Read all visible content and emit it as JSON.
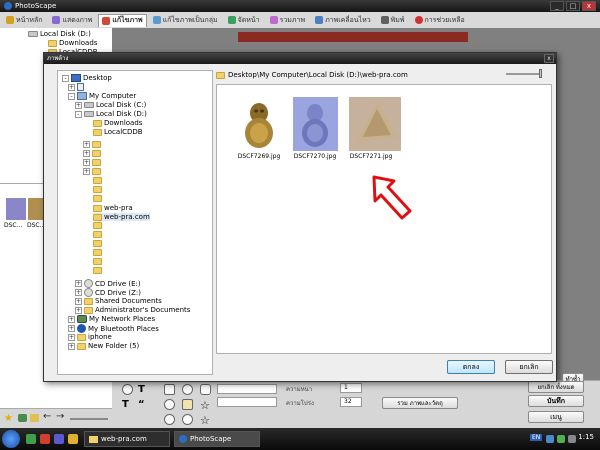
{
  "app": {
    "title": "PhotoScape",
    "tabs": [
      {
        "label": "หน้าหลัก",
        "color": "#d4a020"
      },
      {
        "label": "แสดงภาพ",
        "color": "#8a6ad0"
      },
      {
        "label": "แก้ไขภาพ",
        "color": "#d04a3a"
      },
      {
        "label": "แก้ไขภาพเป็นกลุ่ม",
        "color": "#5a9ad0"
      },
      {
        "label": "จัดหน้า",
        "color": "#3aa060"
      },
      {
        "label": "รวมภาพ",
        "color": "#c06ad0"
      },
      {
        "label": "ภาพเคลื่อนไหว",
        "color": "#4a80c0"
      },
      {
        "label": "พิมพ์",
        "color": "#606060"
      },
      {
        "label": "การช่วยเหลือ",
        "color": "#d03030"
      }
    ],
    "active_tab": 2
  },
  "side_tree": {
    "drive": "Local Disk (D:)",
    "items": [
      "Downloads",
      "LocalCDDB"
    ]
  },
  "side_thumbs": {
    "labels": [
      "DSC...",
      "DSC..."
    ]
  },
  "dialog": {
    "title": "ภาพต้าง",
    "close": "x",
    "path": "Desktop\\My Computer\\Local Disk (D:)\\web-pra.com",
    "tree": {
      "desktop": "Desktop",
      "my_computer": "My Computer",
      "drive_c": "Local Disk (C:)",
      "drive_d": "Local Disk (D:)",
      "d_children": [
        "Downloads",
        "LocalCDDB"
      ],
      "web_pra": "web-pra",
      "web_pra_com": "web-pra.com",
      "drive_e": "CD Drive (E:)",
      "drive_z": "CD Drive (Z:)",
      "shared": "Shared Documents",
      "admin_docs": "Administrator's Documents",
      "network": "My Network Places",
      "bluetooth": "My Bluetooth Places",
      "iphone": "iphone",
      "new_folder": "New Folder (5)"
    },
    "files": [
      {
        "name": "DSCF7269.jpg"
      },
      {
        "name": "DSCF7270.jpg"
      },
      {
        "name": "DSCF7271.jpg"
      }
    ],
    "selected_file": 1,
    "ok_label": "ตกลง",
    "cancel_label": "ยกเลิก"
  },
  "bottom": {
    "label_size": "ความหนา",
    "label_opacity": "ความโปร่ง",
    "size_value": "1",
    "opacity_value": "32",
    "merge_label": "รวม ภาพและวัตถุ",
    "undo_label": "ทำซ้ำ",
    "cancel_all_label": "ยกเลิก ทั้งหมด",
    "save_label": "บันทึก",
    "menu_label": "เมนู"
  },
  "taskbar": {
    "items": [
      {
        "label": "web-pra.com"
      },
      {
        "label": "PhotoScape"
      }
    ],
    "lang": "EN",
    "time": "1:15"
  }
}
